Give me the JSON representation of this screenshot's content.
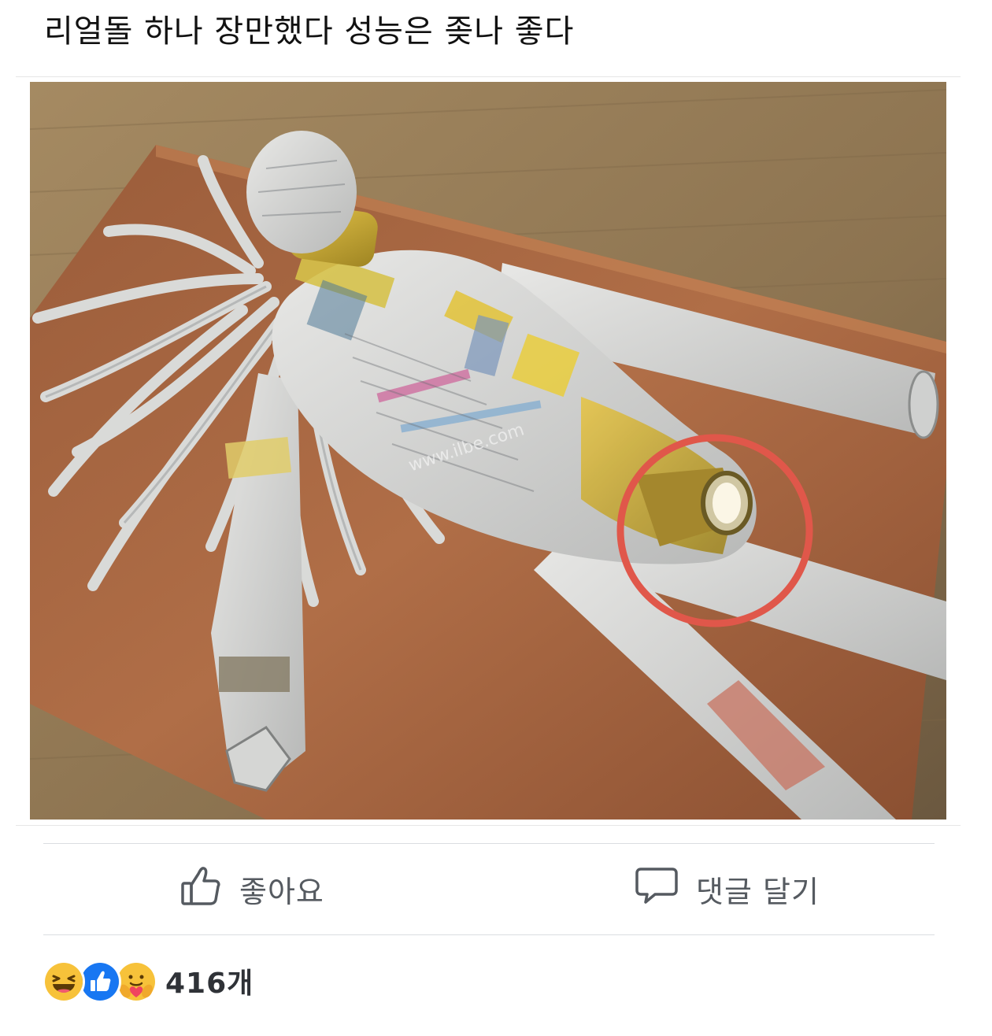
{
  "post": {
    "text": "리얼돌 하나 장만했다 성능은 좆나 좋다",
    "photo_watermark": "www.ilbe.com"
  },
  "actions": {
    "like_label": "좋아요",
    "like_icon": "thumbs-up-icon",
    "comment_label": "댓글 달기",
    "comment_icon": "speech-bubble-icon"
  },
  "reactions": {
    "icons": [
      "haha-reaction-icon",
      "like-reaction-icon",
      "care-reaction-icon"
    ],
    "count": "416개"
  },
  "colors": {
    "action_text": "#555a60",
    "divider": "#dadde1",
    "highlight_circle": "#e0574a",
    "like_blue": "#1877f2",
    "reaction_yellow": "#f7c23a"
  }
}
